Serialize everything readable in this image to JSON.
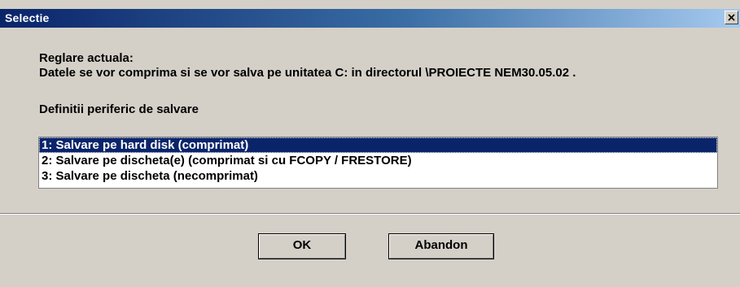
{
  "window": {
    "title": "Selectie",
    "close_glyph": "×"
  },
  "info": {
    "current_setting_label": "Reglare actuala:",
    "current_setting_text": "Datele se vor comprima si se vor salva pe unitatea C: in directorul \\PROIECTE NEM30.05.02 .",
    "device_heading": "Definitii periferic de salvare"
  },
  "list": {
    "selected_index": 0,
    "items": [
      {
        "label": "1: Salvare pe hard disk (comprimat)"
      },
      {
        "label": "2: Salvare pe discheta(e) (comprimat si cu FCOPY / FRESTORE)"
      },
      {
        "label": "3: Salvare pe discheta (necomprimat)"
      }
    ]
  },
  "buttons": {
    "ok_label": "OK",
    "abandon_label": "Abandon"
  },
  "colors": {
    "dialog_face": "#d4d0c8",
    "titlebar_start": "#0a246a",
    "titlebar_end": "#a6caf0",
    "selection": "#0a246a"
  }
}
